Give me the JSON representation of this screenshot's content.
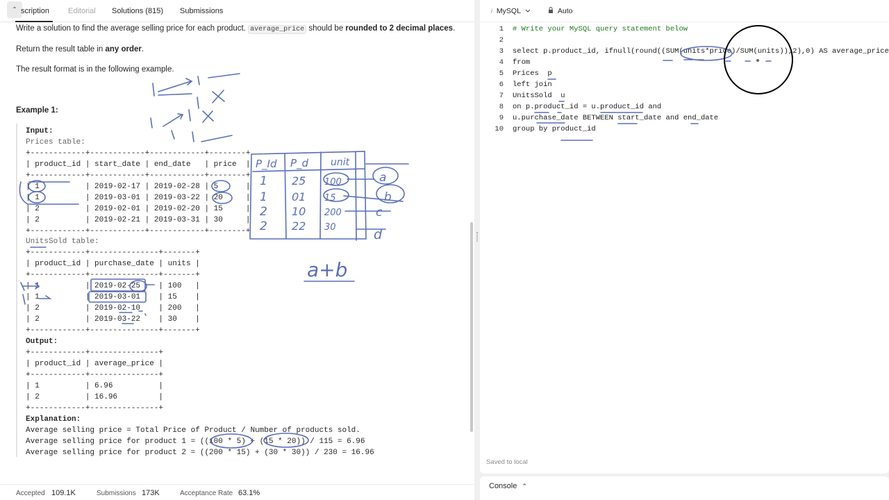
{
  "tabs": {
    "collapse": "⌃",
    "description": "scription",
    "editorial": "Editorial",
    "solutions": "Solutions (815)",
    "submissions": "Submissions"
  },
  "description": {
    "line1_pre": "Write a solution to find the average selling price for each product.",
    "line1_code": "average_price",
    "line1_mid": "should be",
    "line1_bold": "rounded to 2 decimal places",
    "line1_end": ".",
    "line2_pre": "Return the result table in",
    "line2_bold": "any order",
    "line2_end": ".",
    "line3": "The result format is in the following example.",
    "example_title": "Example 1:"
  },
  "example": {
    "input_label": "Input:",
    "prices_label": "Prices table:",
    "prices_lines": [
      "+------------+------------+------------+--------+",
      "| product_id | start_date | end_date   | price  |",
      "+------------+------------+------------+--------+",
      "| 1          | 2019-02-17 | 2019-02-28 | 5      |",
      "| 1          | 2019-03-01 | 2019-03-22 | 20     |",
      "| 2          | 2019-02-01 | 2019-02-20 | 15     |",
      "| 2          | 2019-02-21 | 2019-03-31 | 30     |",
      "+------------+------------+------------+--------+"
    ],
    "units_label": "UnitsSold table:",
    "units_lines": [
      "+------------+---------------+-------+",
      "| product_id | purchase_date | units |",
      "+------------+---------------+-------+",
      "| 1          | 2019-02-25    | 100   |",
      "| 1          | 2019-03-01    | 15    |",
      "| 2          | 2019-02-10    | 200   |",
      "| 2          | 2019-03-22    | 30    |",
      "+------------+---------------+-------+"
    ],
    "output_label": "Output:",
    "output_lines": [
      "+------------+---------------+",
      "| product_id | average_price |",
      "+------------+---------------+",
      "| 1          | 6.96          |",
      "| 2          | 16.96         |",
      "+------------+---------------+"
    ],
    "explanation_label": "Explanation:",
    "explanation_lines": [
      "Average selling price = Total Price of Product / Number of products sold.",
      "Average selling price for product 1 = ((100 * 5) + (15 * 20)) / 115 = 6.96",
      "Average selling price for product 2 = ((200 * 15) + (30 * 30)) / 230 = 16.96"
    ]
  },
  "stats": {
    "accepted_label": "Accepted",
    "accepted_value": "109.1K",
    "submissions_label": "Submissions",
    "submissions_value": "173K",
    "rate_label": "Acceptance Rate",
    "rate_value": "63.1%"
  },
  "editor": {
    "language": "MySQL",
    "auto": "Auto",
    "lang_icon": "info-icon",
    "lock_icon": "lock-icon",
    "line_numbers": [
      "1",
      "2",
      "3",
      "4",
      "5",
      "6",
      "7",
      "8",
      "9",
      "10"
    ],
    "lines": [
      "# Write your MySQL query statement below",
      "",
      "select p.product_id, ifnull(round((SUM(units*price)/SUM(units)),2),0) AS average_price",
      "from",
      "Prices  p",
      "left join",
      "UnitsSold  u",
      "on p.product_id = u.product_id and",
      "u.purchase_date BETWEEN start_date and end_date",
      "group by product_id"
    ],
    "saved": "Saved to local"
  },
  "console": {
    "label": "Console",
    "chevron": "⌃"
  },
  "annotations": {
    "table_headers": [
      "P_Id",
      "P_d",
      "unit"
    ],
    "col1": [
      "1",
      "1",
      "2",
      "2"
    ],
    "col2": [
      "25",
      "01",
      "10",
      "22"
    ],
    "col3": [
      "100",
      "15",
      "200",
      "30"
    ],
    "letters": [
      "a",
      "b",
      "c",
      "d"
    ],
    "sum": "a+b",
    "ink_color": "#5a6fb8"
  }
}
